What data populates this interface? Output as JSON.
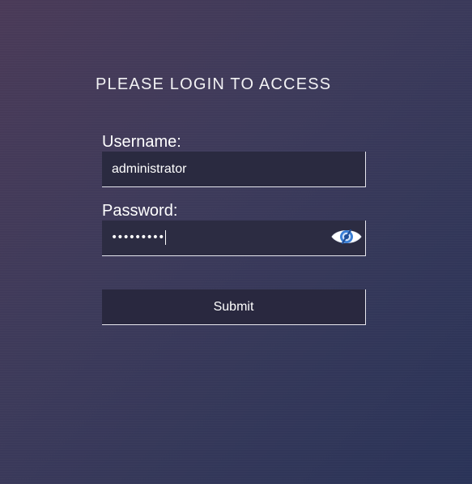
{
  "login": {
    "heading": "PLEASE LOGIN TO ACCESS",
    "username_label": "Username:",
    "username_value": "administrator",
    "password_label": "Password:",
    "password_masked": "•••••••••",
    "show_password_icon": "eye-icon",
    "submit_label": "Submit"
  },
  "colors": {
    "background_start": "#4a3a58",
    "background_end": "#2a3358",
    "field_background": "#2a2a40",
    "eye_icon_accent": "#3a7fd6"
  }
}
